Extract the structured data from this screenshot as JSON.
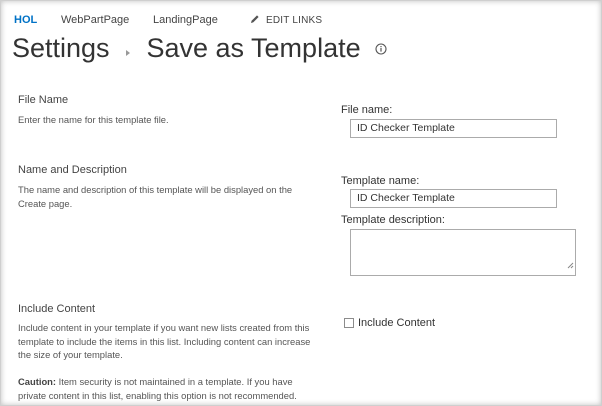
{
  "topnav": {
    "items": [
      {
        "label": "HOL",
        "active": true
      },
      {
        "label": "WebPartPage",
        "active": false
      },
      {
        "label": "LandingPage",
        "active": false
      }
    ],
    "edit_links_label": "EDIT LINKS",
    "edit_links_icon": "pencil-icon"
  },
  "breadcrumb": {
    "parent": "Settings",
    "current": "Save as Template",
    "info_icon": "info-icon"
  },
  "sections": {
    "file_name": {
      "title": "File Name",
      "description": "Enter the name for this template file.",
      "field_label": "File name:",
      "field_value": "ID Checker Template"
    },
    "name_description": {
      "title": "Name and Description",
      "description": "The name and description of this template will be displayed on the Create page.",
      "template_name_label": "Template name:",
      "template_name_value": "ID Checker Template",
      "template_description_label": "Template description:",
      "template_description_value": ""
    },
    "include_content": {
      "title": "Include Content",
      "description": "Include content in your template if you want new lists created from this template to include the items in this list. Including content can increase the size of your template.",
      "caution_label": "Caution:",
      "caution_text": " Item security is not maintained in a template. If you have private content in this list, enabling this option is not recommended.",
      "checkbox_label": "Include Content",
      "checked": false
    }
  },
  "colors": {
    "accent": "#0072c6",
    "text": "#444444",
    "border": "#ababab"
  }
}
